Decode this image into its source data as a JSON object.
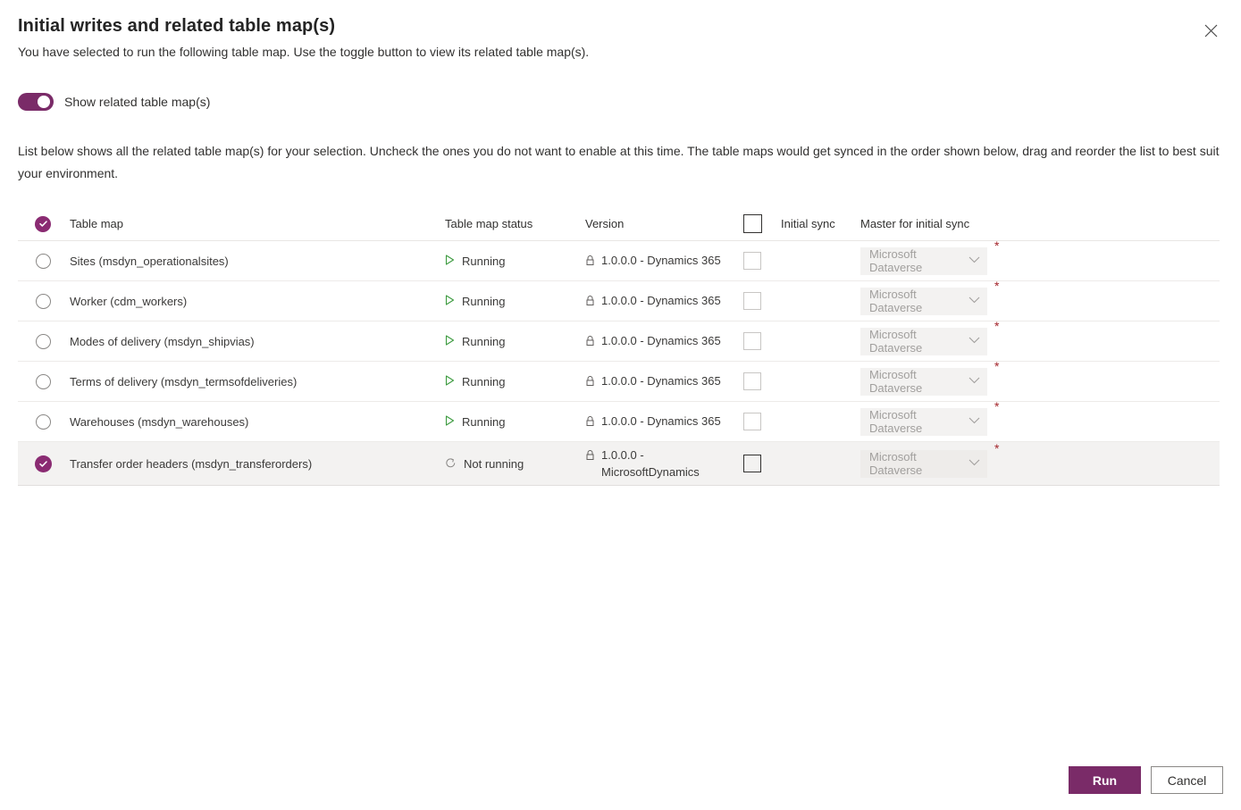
{
  "dialog": {
    "title": "Initial writes and related table map(s)",
    "subtitle": "You have selected to run the following table map. Use the toggle button to view its related table map(s).",
    "close_label": "Close",
    "intro": "List below shows all the related table map(s) for your selection. Uncheck the ones you do not want to enable at this time. The table maps would get synced in the order shown below, drag and reorder the list to best suit your environment."
  },
  "toggle": {
    "label": "Show related table map(s)",
    "state": "on",
    "accent": "#7A2B68"
  },
  "table": {
    "columns": {
      "select": "",
      "table_map": "Table map",
      "status": "Table map status",
      "version": "Version",
      "initial_sync": "Initial sync",
      "master": "Master for initial sync"
    },
    "rows": [
      {
        "name": "Sites (msdyn_operationalsites)",
        "status": "Running",
        "status_icon": "play-icon",
        "version": "1.0.0.0 - Dynamics 365",
        "initial_sync_checked": false,
        "master": "Microsoft Dataverse",
        "selected": false,
        "required": "*"
      },
      {
        "name": "Worker (cdm_workers)",
        "status": "Running",
        "status_icon": "play-icon",
        "version": "1.0.0.0 - Dynamics 365",
        "initial_sync_checked": false,
        "master": "Microsoft Dataverse",
        "selected": false,
        "required": "*"
      },
      {
        "name": "Modes of delivery (msdyn_shipvias)",
        "status": "Running",
        "status_icon": "play-icon",
        "version": "1.0.0.0 - Dynamics 365",
        "initial_sync_checked": false,
        "master": "Microsoft Dataverse",
        "selected": false,
        "required": "*"
      },
      {
        "name": "Terms of delivery (msdyn_termsofdeliveries)",
        "status": "Running",
        "status_icon": "play-icon",
        "version": "1.0.0.0 - Dynamics 365",
        "initial_sync_checked": false,
        "master": "Microsoft Dataverse",
        "selected": false,
        "required": "*"
      },
      {
        "name": "Warehouses (msdyn_warehouses)",
        "status": "Running",
        "status_icon": "play-icon",
        "version": "1.0.0.0 - Dynamics 365",
        "initial_sync_checked": false,
        "master": "Microsoft Dataverse",
        "selected": false,
        "required": "*"
      },
      {
        "name": "Transfer order headers (msdyn_transferorders)",
        "status": "Not running",
        "status_icon": "refresh-icon",
        "version": "1.0.0.0 - MicrosoftDynamics",
        "initial_sync_checked": false,
        "master": "Microsoft Dataverse",
        "selected": true,
        "required": "*"
      }
    ]
  },
  "footer": {
    "run_label": "Run",
    "cancel_label": "Cancel"
  }
}
